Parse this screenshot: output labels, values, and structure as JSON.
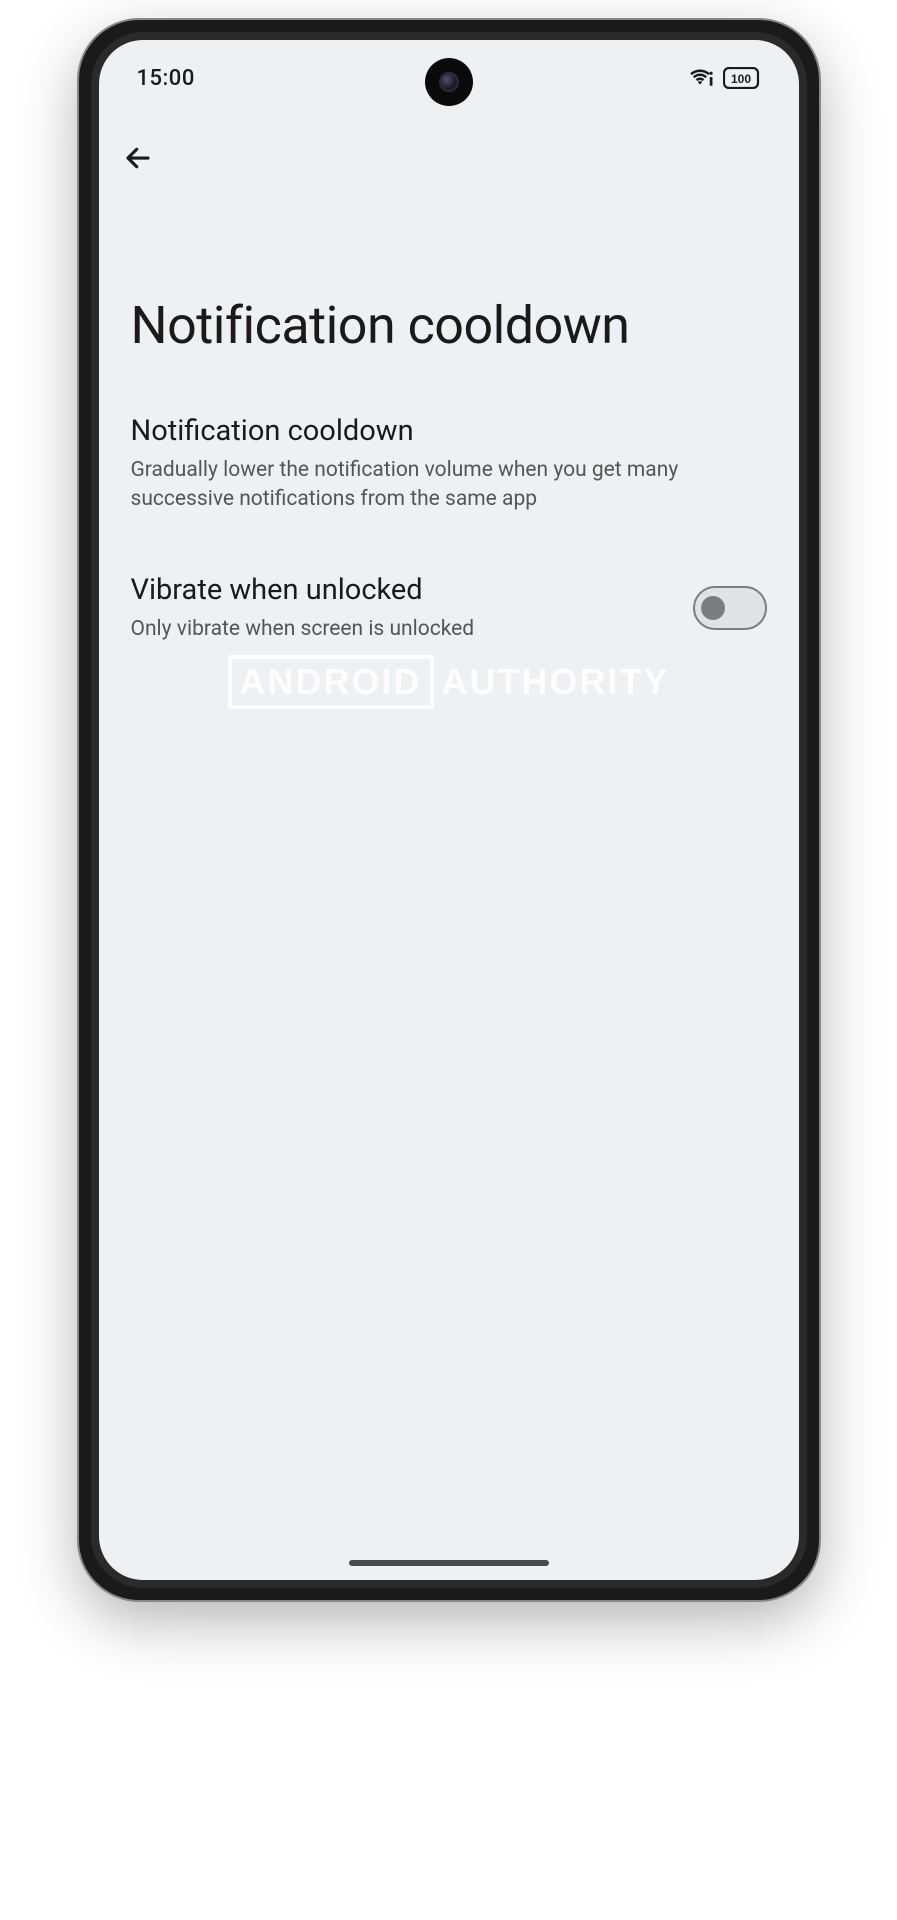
{
  "status_bar": {
    "time": "15:00",
    "battery_text": "100"
  },
  "page": {
    "title": "Notification cooldown"
  },
  "settings": {
    "cooldown": {
      "title": "Notification cooldown",
      "description": "Gradually lower the notification volume when you get many successive notifications from the same app"
    },
    "vibrate": {
      "title": "Vibrate when unlocked",
      "description": "Only vibrate when screen is unlocked",
      "toggle_state": "off"
    }
  },
  "watermark": {
    "part1": "ANDROID",
    "part2": "AUTHORITY"
  }
}
